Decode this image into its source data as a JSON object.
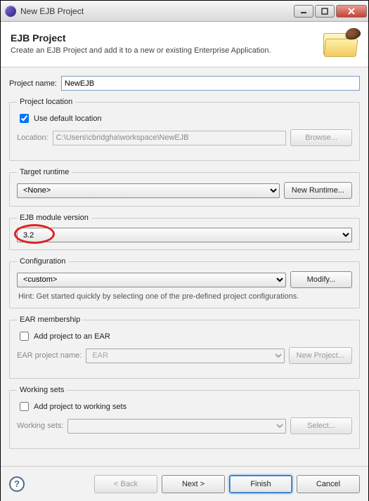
{
  "window": {
    "title": "New EJB Project"
  },
  "header": {
    "title": "EJB Project",
    "subtitle": "Create an EJB Project and add it to a new or existing Enterprise Application."
  },
  "projectName": {
    "label": "Project name:",
    "value": "NewEJB"
  },
  "projectLocation": {
    "legend": "Project location",
    "useDefaultLabel": "Use default location",
    "useDefaultChecked": true,
    "locationLabel": "Location:",
    "locationValue": "C:\\Users\\cbridgha\\workspace\\NewEJB",
    "browseLabel": "Browse..."
  },
  "targetRuntime": {
    "legend": "Target runtime",
    "selected": "<None>",
    "newRuntimeLabel": "New Runtime..."
  },
  "ejbVersion": {
    "legend": "EJB module version",
    "selected": "3.2"
  },
  "configuration": {
    "legend": "Configuration",
    "selected": "<custom>",
    "modifyLabel": "Modify...",
    "hint": "Hint: Get started quickly by selecting one of the pre-defined project configurations."
  },
  "earMembership": {
    "legend": "EAR membership",
    "addLabel": "Add project to an EAR",
    "addChecked": false,
    "earNameLabel": "EAR project name:",
    "earNameValue": "EAR",
    "newProjectLabel": "New Project..."
  },
  "workingSets": {
    "legend": "Working sets",
    "addLabel": "Add project to working sets",
    "addChecked": false,
    "wsLabel": "Working sets:",
    "wsValue": "",
    "selectLabel": "Select..."
  },
  "footer": {
    "back": "< Back",
    "next": "Next >",
    "finish": "Finish",
    "cancel": "Cancel"
  }
}
